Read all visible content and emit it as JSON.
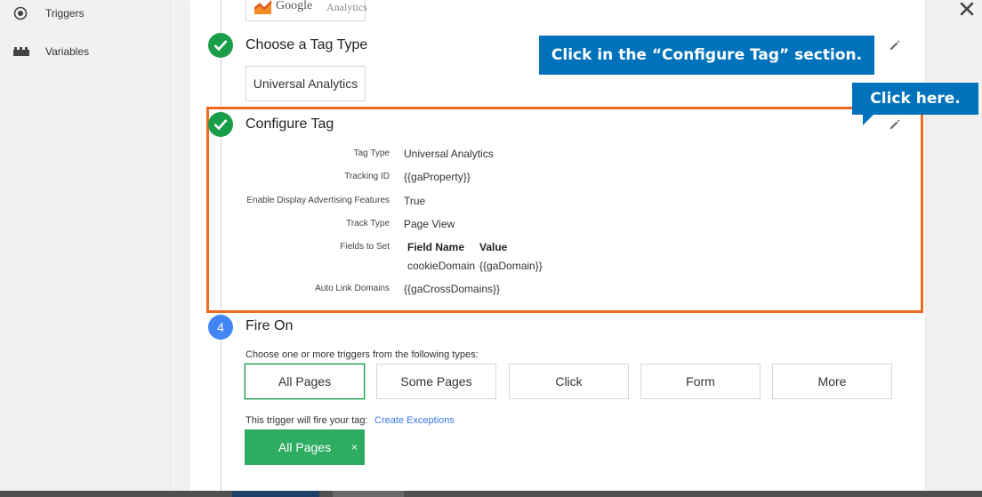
{
  "sidebar": {
    "items": [
      {
        "label": "Triggers",
        "icon": "triggers-icon"
      },
      {
        "label": "Variables",
        "icon": "variables-icon"
      }
    ]
  },
  "brand": {
    "logo_word1": "Google",
    "logo_word2": "Analytics"
  },
  "steps": {
    "tag_type": {
      "title": "Choose a Tag Type",
      "value": "Universal Analytics"
    },
    "configure": {
      "title": "Configure Tag",
      "rows": [
        {
          "label": "Tag Type",
          "value": "Universal Analytics"
        },
        {
          "label": "Tracking ID",
          "value": "{{gaProperty}}"
        },
        {
          "label": "Enable Display Advertising Features",
          "value": "True"
        },
        {
          "label": "Track Type",
          "value": "Page View"
        },
        {
          "label": "Fields to Set"
        },
        {
          "label": "Auto Link Domains",
          "value": "{{gaCrossDomains}}"
        }
      ],
      "fields_to_set": {
        "headers": [
          "Field Name",
          "Value"
        ],
        "rows": [
          [
            "cookieDomain",
            "{{gaDomain}}"
          ]
        ]
      }
    },
    "fire_on": {
      "number": "4",
      "title": "Fire On",
      "description": "Choose one or more triggers from the following types:",
      "triggers": [
        "All Pages",
        "Some Pages",
        "Click",
        "Form",
        "More"
      ],
      "selected_trigger": "All Pages",
      "will_fire_text": "This trigger will fire your tag:",
      "create_exceptions": "Create Exceptions",
      "active_trigger": "All Pages",
      "remove_symbol": "×"
    }
  },
  "callouts": {
    "configure_hint": "Click in the “Configure Tag” section.",
    "click_here": "Click here."
  },
  "colors": {
    "accent_green": "#1a9d49",
    "callout_blue": "#0072bc",
    "highlight_orange": "#ec6b1f",
    "step_blue": "#4285f4"
  }
}
